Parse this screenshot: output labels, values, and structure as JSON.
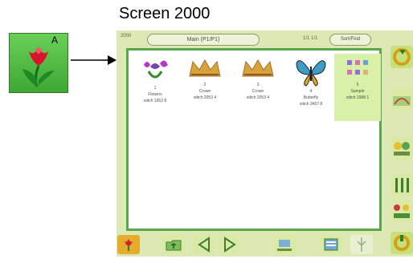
{
  "caption": "Screen 2000",
  "callout": {
    "letter": "A",
    "icon": "tulip-icon"
  },
  "screen": {
    "header": {
      "code": "2000",
      "title": "Main (P1/P1)",
      "page_info": "1/1 1/1",
      "sort_button": "Sort/Find"
    },
    "items": [
      {
        "number": "1",
        "name": "Flowers",
        "stitch": "stitch 1952 8"
      },
      {
        "number": "2",
        "name": "Crown",
        "stitch": "stitch 2053 4"
      },
      {
        "number": "3",
        "name": "Crown",
        "stitch": "stitch 2053 4"
      },
      {
        "number": "4",
        "name": "Butterfly",
        "stitch": "stitch 3457 8"
      },
      {
        "number": "5",
        "name": "Sample",
        "stitch": "stitch 1988 1"
      }
    ],
    "bottom_buttons": [
      "tulip-icon",
      "up-folder-icon",
      "prev-page-icon",
      "next-page-icon",
      "move-icon",
      "menu-icon",
      "tree-icon"
    ],
    "side_buttons": [
      "refresh-icon",
      "design-info-icon",
      "embroidery-icon",
      "thread-icon",
      "palette-icon",
      "settings-icon"
    ],
    "colors": {
      "background": "#dde9b4",
      "content_border": "#58a84a",
      "selected": "#d9f0a8"
    }
  }
}
